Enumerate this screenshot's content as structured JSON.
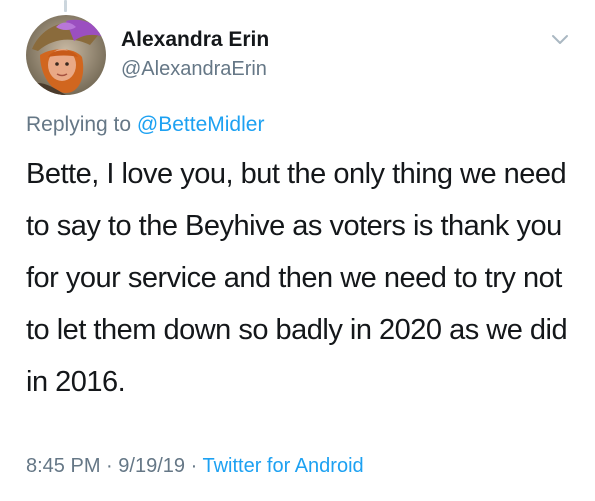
{
  "tweet": {
    "display_name": "Alexandra Erin",
    "handle": "@AlexandraErin",
    "replying_prefix": "Replying to",
    "replying_to": "@BetteMidler",
    "text": "Bette, I love you, but the only thing we need to say to the Beyhive as voters is thank you for your service and then we need to try not to let them down so badly in 2020 as we did in 2016.",
    "time": "8:45 PM",
    "separator": "·",
    "date": "9/19/19",
    "source": "Twitter for Android"
  },
  "icons": {
    "menu": "chevron-down-icon",
    "avatar": "avatar-image"
  },
  "colors": {
    "text": "#14171a",
    "secondary": "#657786",
    "link": "#1da1f2",
    "thread": "#ccd6dd"
  }
}
